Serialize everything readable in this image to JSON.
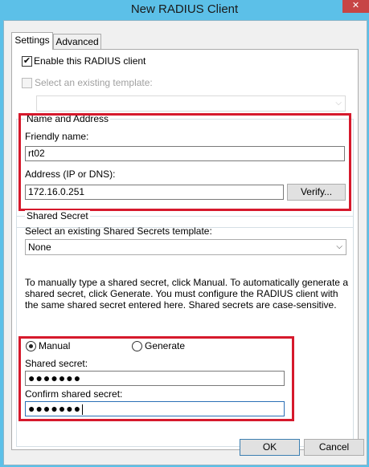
{
  "window": {
    "title": "New RADIUS Client",
    "close_glyph": "✕"
  },
  "tabs": [
    {
      "label": "Settings",
      "active": true
    },
    {
      "label": "Advanced",
      "active": false
    }
  ],
  "settings": {
    "enable_client": {
      "label": "Enable this RADIUS client",
      "checked": true
    },
    "existing_template": {
      "label": "Select an existing template:",
      "checked": false,
      "enabled": false,
      "value": ""
    },
    "name_address": {
      "legend": "Name and Address",
      "friendly_name_label": "Friendly name:",
      "friendly_name_value": "rt02",
      "address_label": "Address (IP or DNS):",
      "address_value": "172.16.0.251",
      "verify_label": "Verify..."
    },
    "shared_secret": {
      "legend": "Shared Secret",
      "template_label": "Select an existing Shared Secrets template:",
      "template_value": "None",
      "description": "To manually type a shared secret, click Manual. To automatically generate a shared secret, click Generate. You must configure the RADIUS client with the same shared secret entered here. Shared secrets are case-sensitive.",
      "manual_label": "Manual",
      "generate_label": "Generate",
      "selected_mode": "Manual",
      "secret_label": "Shared secret:",
      "secret_value": "●●●●●●●",
      "confirm_label": "Confirm shared secret:",
      "confirm_value": "●●●●●●●"
    }
  },
  "footer": {
    "ok_label": "OK",
    "cancel_label": "Cancel"
  },
  "colors": {
    "titlebar": "#5cc0e8",
    "highlight": "#d6192c",
    "close": "#c74545"
  }
}
